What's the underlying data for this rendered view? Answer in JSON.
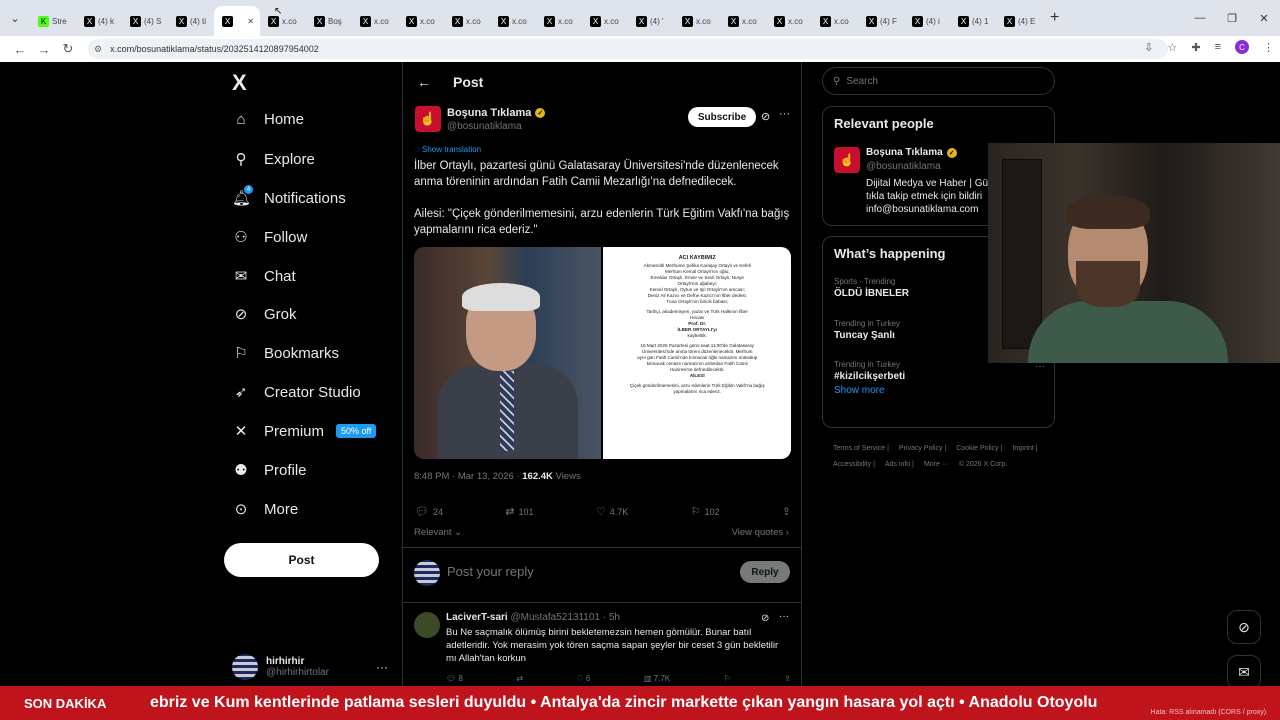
{
  "browser": {
    "tabs": [
      {
        "icon": "K",
        "label": "Stre"
      },
      {
        "icon": "X",
        "label": "(4) k"
      },
      {
        "icon": "X",
        "label": "(4) S"
      },
      {
        "icon": "X",
        "label": "(4) ti"
      },
      {
        "icon": "X",
        "label": "",
        "active": true
      },
      {
        "icon": "X",
        "label": "x.co"
      },
      {
        "icon": "X",
        "label": "Boş"
      },
      {
        "icon": "X",
        "label": "x.co"
      },
      {
        "icon": "X",
        "label": "x.co"
      },
      {
        "icon": "X",
        "label": "x.co"
      },
      {
        "icon": "X",
        "label": "x.co"
      },
      {
        "icon": "X",
        "label": "x.co"
      },
      {
        "icon": "X",
        "label": "x.co"
      },
      {
        "icon": "X",
        "label": "(4) '"
      },
      {
        "icon": "X",
        "label": "x.co"
      },
      {
        "icon": "X",
        "label": "x.co"
      },
      {
        "icon": "X",
        "label": "x.co"
      },
      {
        "icon": "X",
        "label": "x.co"
      },
      {
        "icon": "X",
        "label": "(4) F"
      },
      {
        "icon": "X",
        "label": "(4) i"
      },
      {
        "icon": "X",
        "label": "(4) 1"
      },
      {
        "icon": "X",
        "label": "(4) E"
      }
    ],
    "new_tab": "+",
    "url": "x.com/bosunatiklama/status/2032514120897954002",
    "profile_initial": "C"
  },
  "nav": {
    "logo": "X",
    "items": [
      {
        "label": "Home",
        "icon": "home-icon"
      },
      {
        "label": "Explore",
        "icon": "search-icon"
      },
      {
        "label": "Notifications",
        "icon": "bell-icon",
        "badge": "4"
      },
      {
        "label": "Follow",
        "icon": "follow-icon"
      },
      {
        "label": "Chat",
        "icon": "mail-icon"
      },
      {
        "label": "Grok",
        "icon": "grok-icon"
      },
      {
        "label": "Bookmarks",
        "icon": "bookmark-icon"
      },
      {
        "label": "Creator Studio",
        "icon": "rocket-icon"
      },
      {
        "label": "Premium",
        "icon": "x-icon",
        "tag": "50% off"
      },
      {
        "label": "Profile",
        "icon": "person-icon"
      },
      {
        "label": "More",
        "icon": "more-circle-icon"
      }
    ],
    "post_button": "Post",
    "account": {
      "name": "hirhirhir",
      "handle": "@hirhirhirtolar"
    }
  },
  "post": {
    "header": "Post",
    "author": {
      "name": "Boşuna Tıklama",
      "handle": "@bosunatiklama"
    },
    "subscribe": "Subscribe",
    "show_translation": "Show translation",
    "text": "İlber Ortaylı, pazartesi günü Galatasaray Üniversitesi'nde düzenlenecek anma töreninin ardından Fatih Camii Mezarlığı'na defnedilecek.\n\nAilesi: \"Çiçek gönderilmemesini, arzu edenlerin Türk Eğitim Vakfı'na bağış yapmalarını rica ederiz.\"",
    "notice": {
      "title": "ACI KAYBIMIZ",
      "lines": [
        "Akmescitli Merhume Şefika Karaşay Ortaylı ve Kefeli",
        "Merhum Kemal Ortaylı'nın oğlu;",
        "Emeldar Ortaylı, Enver ve Sevil Ortaylı, Nurye",
        "Ortaylı'nın ağabeyi;",
        "Kemal Ortaylı, Oytun ve Işıl Ortaylı'nın amcası;",
        "Deniz Ali Kazıcı ve Defne Kazıcı'nın İlber dedesi;",
        "Tuna Ortaylı'nın biricik babası;",
        "",
        "Tarihçi, akademisyen, yazar ve Türk Halkının İlber",
        "Hocası",
        "Prof. Dr.",
        "İLBER ORTAYLI'yı",
        "kaybettik.",
        "",
        "16 Mart 2026 Pazartesi günü saat 11:00'de Galatasaray",
        "Üniversitesi'nde anma töreni düzenlenecektir. Merhum",
        "aynı gün Fatih Camii'nde kılınacak öğle namazını müteakip",
        "kılınacak cenaze namazının ardından Fatih Camii",
        "Haziresi'ne defnedilecektir.",
        "AİLESİ",
        "",
        "Çiçek gönderilmemesini, arzu edenlerin Türk Eğitim Vakfı'na bağış",
        "yapmalarını rica ederiz."
      ]
    },
    "time": "8:48 PM · Mar 13, 2026 · ",
    "views": "162.4K",
    "views_label": " Views",
    "stats": {
      "replies": "24",
      "reposts": "101",
      "likes": "4.7K",
      "bookmarks": "102"
    },
    "relevant": "Relevant ⌄",
    "view_quotes": "View quotes ›",
    "reply_placeholder": "Post your reply",
    "reply_button": "Reply"
  },
  "comment": {
    "name": "LaciverT-sari",
    "meta": " @Mustafa52131101 · 5h",
    "text": "Bu Ne saçmalık ölümüş birini bekletemezsin hemen gömülür. Bunar batıl adetleridir. Yok merasim yok tören saçma sapan şeyler bir ceset 3 gün bekletilir mı Allah'tan korkun",
    "stats": {
      "replies": "8",
      "reposts": "",
      "likes": "6",
      "views": "7.7K"
    }
  },
  "sidebar": {
    "search_placeholder": "Search",
    "relevant_title": "Relevant people",
    "person": {
      "name": "Boşuna Tıklama",
      "handle": "@bosunatiklama",
      "bio": "Dijital Medya ve Haber | Gü\ntıkla takip etmek için bildiri\ninfo@bosunatiklama.com"
    },
    "happening_title": "What’s happening",
    "trends": [
      {
        "context": "Sports · Trending",
        "topic": "ÖLDÜ İBNELER"
      },
      {
        "context": "Trending in Turkey",
        "topic": "Tuncay Şanlı"
      },
      {
        "context": "Trending in Turkey",
        "topic": "#kizilcikşerbeti"
      }
    ],
    "show_more": "Show more",
    "footer": [
      "Terms of Service |",
      "Privacy Policy |",
      "Cookie Policy |",
      "Imprint |",
      "Accessibility |",
      "Ads info |",
      "More ···",
      "© 2026 X Corp."
    ]
  },
  "ticker": {
    "label": "SON DAKİKA",
    "text": "ebriz ve Kum kentlerinde patlama sesleri duyuldu   •   Antalya'da zincir markette çıkan yangın hasara yol açtı   •   Anadolu Otoyolu",
    "error": "Hata: RSS alınamadı (CORS / proxy)."
  },
  "colors": {
    "accent": "#1d9bf0",
    "verified": "#e2b719",
    "ticker": "#c0141d",
    "brand_red": "#c8102e"
  }
}
